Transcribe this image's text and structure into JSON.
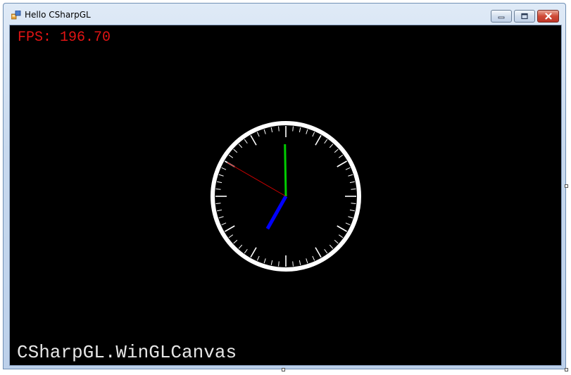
{
  "window": {
    "title": "Hello CSharpGL",
    "icon": "app-icon",
    "buttons": {
      "minimize": "minimize-icon",
      "maximize": "maximize-icon",
      "close": "close-icon"
    }
  },
  "canvas": {
    "fps_text": "FPS: 196.70",
    "label": "CSharpGL.WinGLCanvas",
    "fps_color": "#e01414",
    "label_color": "#e6e6e6",
    "background": "#000000"
  },
  "clock": {
    "time": "6:59:50",
    "hour_hand_color": "#0000ff",
    "minute_hand_color": "#00cc00",
    "second_hand_color": "#cc0000",
    "face_color": "#ffffff"
  }
}
